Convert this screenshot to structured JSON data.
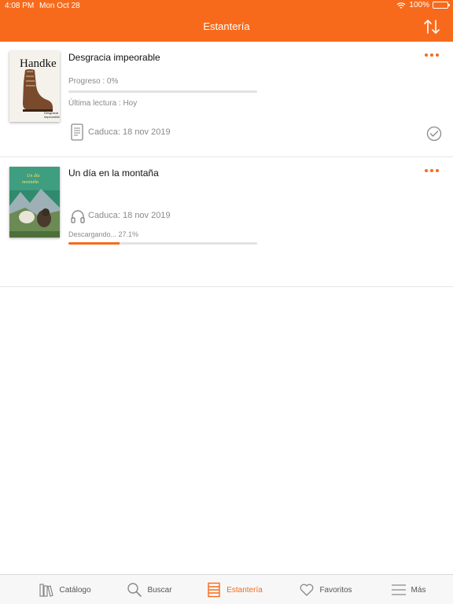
{
  "status_bar": {
    "time": "4:08 PM",
    "date": "Mon Oct 28",
    "battery": "100%"
  },
  "header": {
    "title": "Estantería",
    "sort_icon": "sort-arrows-icon"
  },
  "books": [
    {
      "title": "Desgracia impeorable",
      "cover_author": "Handke",
      "cover_subtitle": "Desgracia impeorable",
      "progress_label": "Progreso : 0%",
      "progress": 0,
      "last_read": "Última lectura : Hoy",
      "expires": "Caduca: 18 nov 2019",
      "format_icon": "document-icon",
      "status_icon": "check-circle-icon"
    },
    {
      "title": "Un día en la montaña",
      "cover_title": "Un día en la montaña",
      "expires": "Caduca: 18 nov 2019",
      "format_icon": "headphones-icon",
      "download_label": "Descargando... 27.1%",
      "download_progress": 0.271
    }
  ],
  "tabs": [
    {
      "label": "Catálogo",
      "icon": "books-icon",
      "active": false
    },
    {
      "label": "Buscar",
      "icon": "search-icon",
      "active": false
    },
    {
      "label": "Estantería",
      "icon": "shelf-icon",
      "active": true
    },
    {
      "label": "Favoritos",
      "icon": "heart-icon",
      "active": false
    },
    {
      "label": "Más",
      "icon": "menu-icon",
      "active": false
    }
  ],
  "colors": {
    "accent": "#f86a1b",
    "muted": "#8a8a8a"
  }
}
